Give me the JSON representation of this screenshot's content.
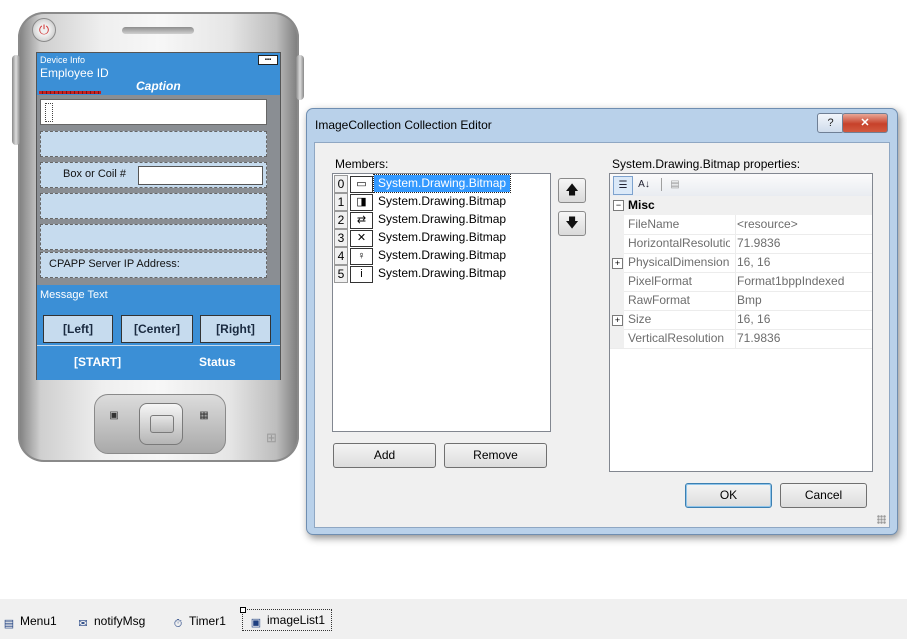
{
  "device": {
    "title_small": "Device Info",
    "title_big": "Employee ID",
    "caption": "Caption",
    "signal_icon": "battery-signal-icon",
    "box_or_coil_label": "Box or Coil #",
    "server_ip_label": "CPAPP Server IP Address:",
    "message_text": "Message Text",
    "left_button": "[Left]",
    "center_button": "[Center]",
    "right_button": "[Right]",
    "start_menu": "[START]",
    "status_menu": "Status"
  },
  "dialog": {
    "title": "ImageCollection Collection Editor",
    "help_label": "?",
    "close_label": "✕",
    "members_label": "Members:",
    "members": [
      {
        "index": "0",
        "name": "System.Drawing.Bitmap",
        "icon": "▭"
      },
      {
        "index": "1",
        "name": "System.Drawing.Bitmap",
        "icon": "◨"
      },
      {
        "index": "2",
        "name": "System.Drawing.Bitmap",
        "icon": "⇄"
      },
      {
        "index": "3",
        "name": "System.Drawing.Bitmap",
        "icon": "✕"
      },
      {
        "index": "4",
        "name": "System.Drawing.Bitmap",
        "icon": "♀"
      },
      {
        "index": "5",
        "name": "System.Drawing.Bitmap",
        "icon": "i"
      }
    ],
    "selected_index": 0,
    "move_up_label": "🡅",
    "move_down_label": "🡇",
    "add_label": "Add",
    "remove_label": "Remove",
    "properties_label": "System.Drawing.Bitmap properties:",
    "toolbar": {
      "categorized_icon": "☰",
      "alphabetical_icon": "A↓",
      "property_pages_icon": "▤"
    },
    "category": "Misc",
    "properties": [
      {
        "name": "FileName",
        "value": "<resource>",
        "expandable": false
      },
      {
        "name": "HorizontalResolution",
        "value": "71.9836",
        "expandable": false
      },
      {
        "name": "PhysicalDimension",
        "value": "16, 16",
        "expandable": true
      },
      {
        "name": "PixelFormat",
        "value": "Format1bppIndexed",
        "expandable": false
      },
      {
        "name": "RawFormat",
        "value": "Bmp",
        "expandable": false
      },
      {
        "name": "Size",
        "value": "16, 16",
        "expandable": true
      },
      {
        "name": "VerticalResolution",
        "value": "71.9836",
        "expandable": false
      }
    ],
    "ok_label": "OK",
    "cancel_label": "Cancel"
  },
  "tray": {
    "items": [
      {
        "label": "Menu1",
        "icon": "menu-icon",
        "glyph": "▤"
      },
      {
        "label": "notifyMsg",
        "icon": "notify-icon",
        "glyph": "✉"
      },
      {
        "label": "Timer1",
        "icon": "timer-icon",
        "glyph": "⏱"
      },
      {
        "label": "imageList1",
        "icon": "image-list-icon",
        "glyph": "▣"
      }
    ],
    "selected": "imageList1"
  }
}
